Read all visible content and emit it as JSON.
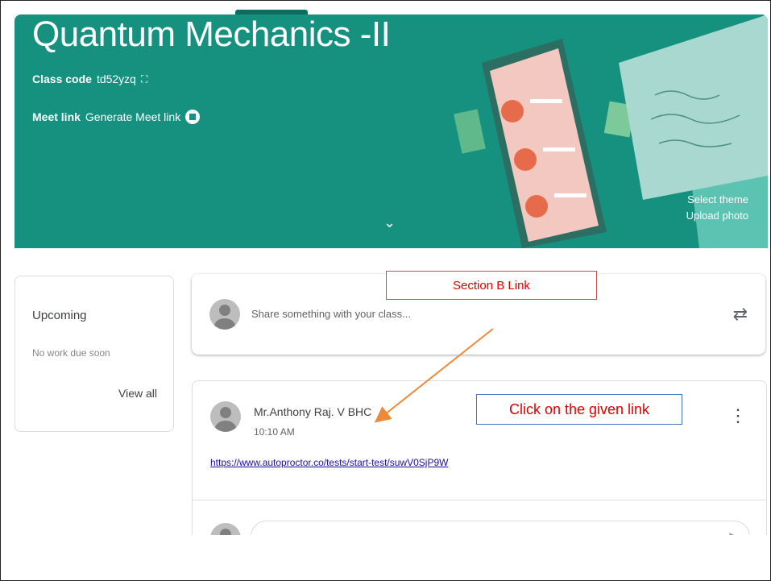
{
  "banner": {
    "title": "Quantum Mechanics -II",
    "class_code_label": "Class code",
    "class_code_value": "td52yzq",
    "meet_link_label": "Meet link",
    "meet_link_action": "Generate Meet link",
    "select_theme": "Select theme",
    "upload_photo": "Upload photo",
    "color": "#16907f"
  },
  "upcoming": {
    "title": "Upcoming",
    "subtitle": "No work due soon",
    "view_all": "View all"
  },
  "share": {
    "placeholder": "Share something with your class..."
  },
  "post": {
    "author": "Mr.Anthony Raj. V BHC",
    "time": "10:10 AM",
    "link": "https://www.autoproctor.co/tests/start-test/suwV0SjP9W"
  },
  "annotations": {
    "section_b": "Section B Link",
    "click_note": "Click on the given link"
  },
  "icons": [
    "copy-code-icon",
    "meet-icon",
    "chevron-down-icon",
    "avatar-icon",
    "repost-icon",
    "more-vert-icon",
    "send-icon"
  ]
}
